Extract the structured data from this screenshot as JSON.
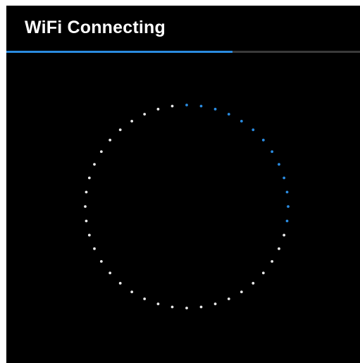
{
  "header": {
    "title": "WiFi Connecting"
  },
  "progress": {
    "fraction": 0.64
  },
  "spinner": {
    "dot_count": 44,
    "active_dots": 13
  },
  "colors": {
    "background": "#000000",
    "title": "#ffffff",
    "accent": "#2a8be0",
    "track": "#3a3a3a",
    "dot_inactive": "#e8e8e8",
    "dot_active": "#2a8be0"
  }
}
